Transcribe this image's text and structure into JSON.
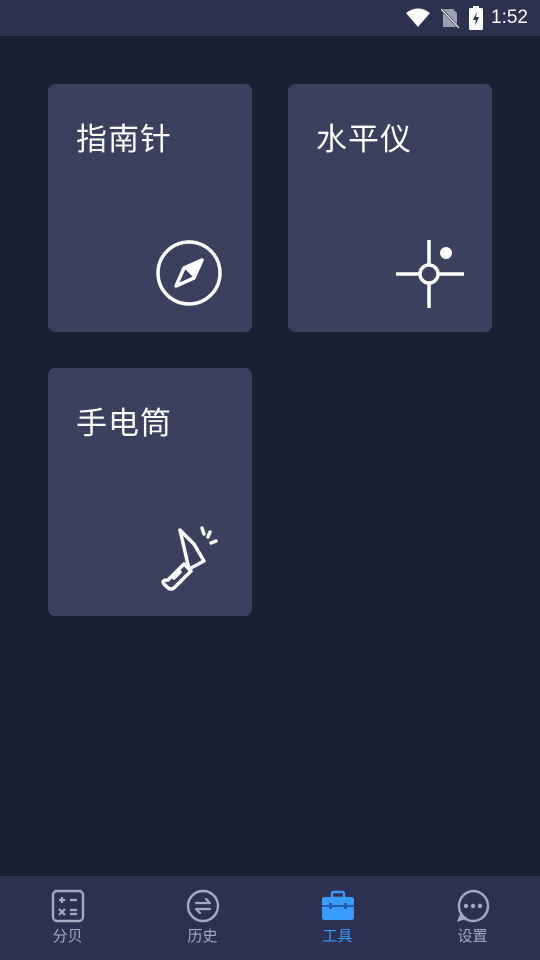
{
  "status_bar": {
    "time": "1:52",
    "icons": [
      "wifi-icon",
      "no-sim-icon",
      "battery-charging-icon"
    ]
  },
  "tools": [
    {
      "label": "指南针",
      "icon": "compass-icon"
    },
    {
      "label": "水平仪",
      "icon": "level-crosshair-icon"
    },
    {
      "label": "手电筒",
      "icon": "flashlight-icon"
    }
  ],
  "bottom_nav": {
    "items": [
      {
        "label": "分贝",
        "icon": "calculator-icon"
      },
      {
        "label": "历史",
        "icon": "history-exchange-icon"
      },
      {
        "label": "工具",
        "icon": "toolbox-icon"
      },
      {
        "label": "设置",
        "icon": "settings-dots-icon"
      }
    ],
    "active_index": 2,
    "active_color": "#3a9bff",
    "inactive_color": "#a6a9bf"
  },
  "colors": {
    "background": "#1b1f34",
    "card": "#3b405e",
    "bars": "#2d3150"
  }
}
